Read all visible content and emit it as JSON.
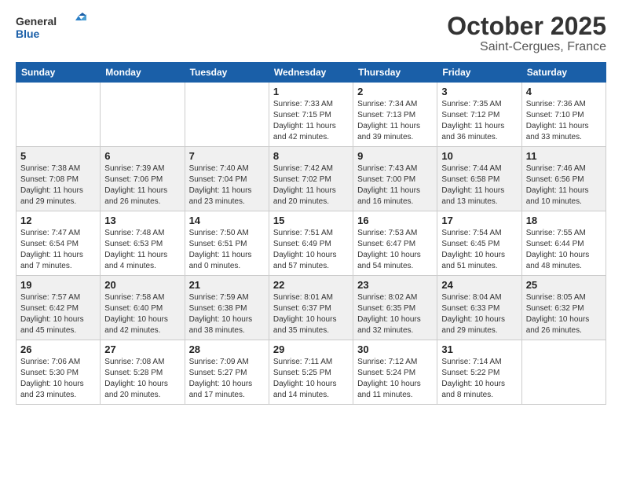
{
  "header": {
    "logo_line1": "General",
    "logo_line2": "Blue",
    "month": "October 2025",
    "location": "Saint-Cergues, France"
  },
  "weekdays": [
    "Sunday",
    "Monday",
    "Tuesday",
    "Wednesday",
    "Thursday",
    "Friday",
    "Saturday"
  ],
  "weeks": [
    [
      {
        "day": "",
        "info": ""
      },
      {
        "day": "",
        "info": ""
      },
      {
        "day": "",
        "info": ""
      },
      {
        "day": "1",
        "info": "Sunrise: 7:33 AM\nSunset: 7:15 PM\nDaylight: 11 hours\nand 42 minutes."
      },
      {
        "day": "2",
        "info": "Sunrise: 7:34 AM\nSunset: 7:13 PM\nDaylight: 11 hours\nand 39 minutes."
      },
      {
        "day": "3",
        "info": "Sunrise: 7:35 AM\nSunset: 7:12 PM\nDaylight: 11 hours\nand 36 minutes."
      },
      {
        "day": "4",
        "info": "Sunrise: 7:36 AM\nSunset: 7:10 PM\nDaylight: 11 hours\nand 33 minutes."
      }
    ],
    [
      {
        "day": "5",
        "info": "Sunrise: 7:38 AM\nSunset: 7:08 PM\nDaylight: 11 hours\nand 29 minutes."
      },
      {
        "day": "6",
        "info": "Sunrise: 7:39 AM\nSunset: 7:06 PM\nDaylight: 11 hours\nand 26 minutes."
      },
      {
        "day": "7",
        "info": "Sunrise: 7:40 AM\nSunset: 7:04 PM\nDaylight: 11 hours\nand 23 minutes."
      },
      {
        "day": "8",
        "info": "Sunrise: 7:42 AM\nSunset: 7:02 PM\nDaylight: 11 hours\nand 20 minutes."
      },
      {
        "day": "9",
        "info": "Sunrise: 7:43 AM\nSunset: 7:00 PM\nDaylight: 11 hours\nand 16 minutes."
      },
      {
        "day": "10",
        "info": "Sunrise: 7:44 AM\nSunset: 6:58 PM\nDaylight: 11 hours\nand 13 minutes."
      },
      {
        "day": "11",
        "info": "Sunrise: 7:46 AM\nSunset: 6:56 PM\nDaylight: 11 hours\nand 10 minutes."
      }
    ],
    [
      {
        "day": "12",
        "info": "Sunrise: 7:47 AM\nSunset: 6:54 PM\nDaylight: 11 hours\nand 7 minutes."
      },
      {
        "day": "13",
        "info": "Sunrise: 7:48 AM\nSunset: 6:53 PM\nDaylight: 11 hours\nand 4 minutes."
      },
      {
        "day": "14",
        "info": "Sunrise: 7:50 AM\nSunset: 6:51 PM\nDaylight: 11 hours\nand 0 minutes."
      },
      {
        "day": "15",
        "info": "Sunrise: 7:51 AM\nSunset: 6:49 PM\nDaylight: 10 hours\nand 57 minutes."
      },
      {
        "day": "16",
        "info": "Sunrise: 7:53 AM\nSunset: 6:47 PM\nDaylight: 10 hours\nand 54 minutes."
      },
      {
        "day": "17",
        "info": "Sunrise: 7:54 AM\nSunset: 6:45 PM\nDaylight: 10 hours\nand 51 minutes."
      },
      {
        "day": "18",
        "info": "Sunrise: 7:55 AM\nSunset: 6:44 PM\nDaylight: 10 hours\nand 48 minutes."
      }
    ],
    [
      {
        "day": "19",
        "info": "Sunrise: 7:57 AM\nSunset: 6:42 PM\nDaylight: 10 hours\nand 45 minutes."
      },
      {
        "day": "20",
        "info": "Sunrise: 7:58 AM\nSunset: 6:40 PM\nDaylight: 10 hours\nand 42 minutes."
      },
      {
        "day": "21",
        "info": "Sunrise: 7:59 AM\nSunset: 6:38 PM\nDaylight: 10 hours\nand 38 minutes."
      },
      {
        "day": "22",
        "info": "Sunrise: 8:01 AM\nSunset: 6:37 PM\nDaylight: 10 hours\nand 35 minutes."
      },
      {
        "day": "23",
        "info": "Sunrise: 8:02 AM\nSunset: 6:35 PM\nDaylight: 10 hours\nand 32 minutes."
      },
      {
        "day": "24",
        "info": "Sunrise: 8:04 AM\nSunset: 6:33 PM\nDaylight: 10 hours\nand 29 minutes."
      },
      {
        "day": "25",
        "info": "Sunrise: 8:05 AM\nSunset: 6:32 PM\nDaylight: 10 hours\nand 26 minutes."
      }
    ],
    [
      {
        "day": "26",
        "info": "Sunrise: 7:06 AM\nSunset: 5:30 PM\nDaylight: 10 hours\nand 23 minutes."
      },
      {
        "day": "27",
        "info": "Sunrise: 7:08 AM\nSunset: 5:28 PM\nDaylight: 10 hours\nand 20 minutes."
      },
      {
        "day": "28",
        "info": "Sunrise: 7:09 AM\nSunset: 5:27 PM\nDaylight: 10 hours\nand 17 minutes."
      },
      {
        "day": "29",
        "info": "Sunrise: 7:11 AM\nSunset: 5:25 PM\nDaylight: 10 hours\nand 14 minutes."
      },
      {
        "day": "30",
        "info": "Sunrise: 7:12 AM\nSunset: 5:24 PM\nDaylight: 10 hours\nand 11 minutes."
      },
      {
        "day": "31",
        "info": "Sunrise: 7:14 AM\nSunset: 5:22 PM\nDaylight: 10 hours\nand 8 minutes."
      },
      {
        "day": "",
        "info": ""
      }
    ]
  ]
}
